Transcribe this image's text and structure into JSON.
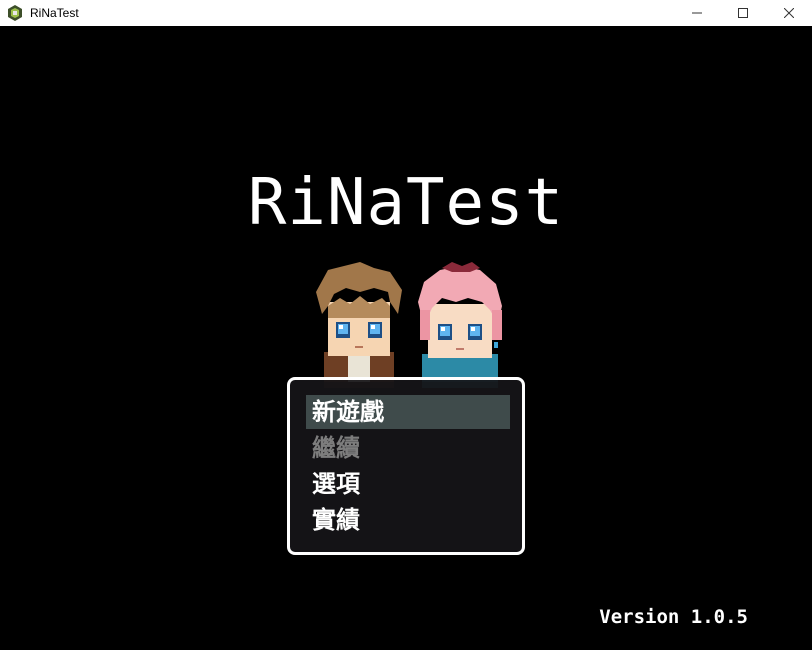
{
  "window": {
    "title": "RiNaTest",
    "icon": "rpg-maker-app-icon",
    "controls": [
      "minimize-icon",
      "maximize-icon",
      "close-icon"
    ]
  },
  "game": {
    "title": "RiNaTest",
    "version": "Version 1.0.5",
    "characters": [
      "brown-haired-boy-sprite",
      "pink-haired-girl-sprite"
    ]
  },
  "menu": {
    "items": [
      {
        "label": "新遊戲",
        "state": "selected"
      },
      {
        "label": "繼續",
        "state": "disabled"
      },
      {
        "label": "選項",
        "state": "enabled"
      },
      {
        "label": "實績",
        "state": "enabled"
      }
    ],
    "colors": {
      "border": "#ffffff",
      "selection": "#3f4b4b",
      "disabled_text": "#7d7d7d"
    }
  }
}
